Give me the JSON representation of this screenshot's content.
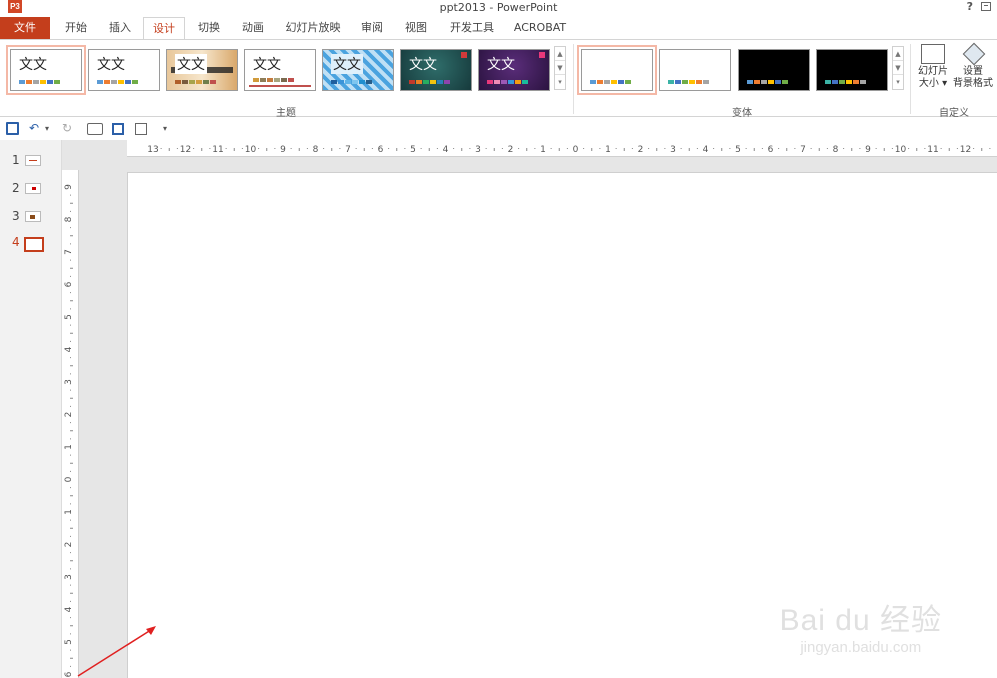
{
  "window": {
    "app_logo": "P3",
    "title": "ppt2013 - PowerPoint",
    "help": "?"
  },
  "tabs": {
    "file": "文件",
    "items": [
      "开始",
      "插入",
      "设计",
      "切换",
      "动画",
      "幻灯片放映",
      "审阅",
      "视图",
      "开发工具",
      "ACROBAT"
    ],
    "active": "设计"
  },
  "ribbon": {
    "themes_group_label": "主题",
    "variants_group_label": "变体",
    "customize_group_label": "自定义",
    "theme_text": "文文",
    "slide_size": {
      "line1": "幻灯片",
      "line2": "大小"
    },
    "format_background": {
      "line1": "设置",
      "line2": "背景格式"
    },
    "colors": {
      "accent": "#c43e1c"
    }
  },
  "thumbnails": {
    "items": [
      {
        "num": "1"
      },
      {
        "num": "2"
      },
      {
        "num": "3"
      },
      {
        "num": "4"
      }
    ],
    "active": "4"
  },
  "ruler": {
    "horizontal": [
      "13",
      "12",
      "11",
      "10",
      "9",
      "8",
      "7",
      "6",
      "5",
      "4",
      "3",
      "2",
      "1",
      "0",
      "1",
      "2",
      "3",
      "4",
      "5",
      "6",
      "7",
      "8",
      "9",
      "10",
      "11",
      "12"
    ],
    "vertical": [
      "9",
      "8",
      "7",
      "6",
      "5",
      "4",
      "3",
      "2",
      "1",
      "0",
      "1",
      "2",
      "3",
      "4",
      "5",
      "6"
    ]
  },
  "watermark": {
    "brand": "Bai du 经验",
    "url": "jingyan.baidu.com"
  }
}
